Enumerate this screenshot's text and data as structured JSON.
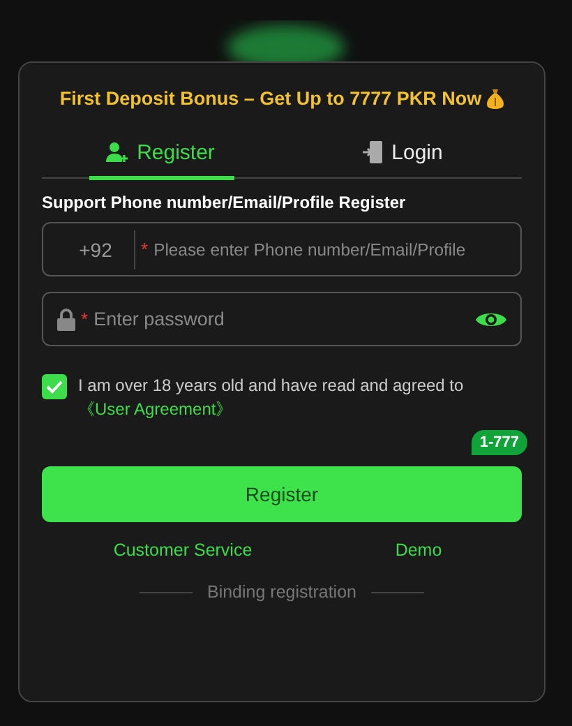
{
  "bonus_banner": {
    "text": "First Deposit Bonus – Get Up to 7777 PKR Now"
  },
  "tabs": [
    {
      "label": "Register",
      "kind": "register",
      "selected": true
    },
    {
      "label": "Login",
      "kind": "login",
      "selected": false
    }
  ],
  "form_label": "Support Phone number/Email/Profile Register",
  "phone_field": {
    "country_code": "+92",
    "required_mark": "*",
    "placeholder": "Please enter Phone number/Email/Profile"
  },
  "password_field": {
    "required_mark": "*",
    "placeholder": "Enter password"
  },
  "agreement": {
    "checked": true,
    "text": "I am over 18 years old and have read and agreed to",
    "link": "《User Agreement》"
  },
  "promo_badge": "1-777",
  "submit_button": "Register",
  "links": [
    "Customer Service",
    "Demo"
  ],
  "divider_text": "Binding registration"
}
